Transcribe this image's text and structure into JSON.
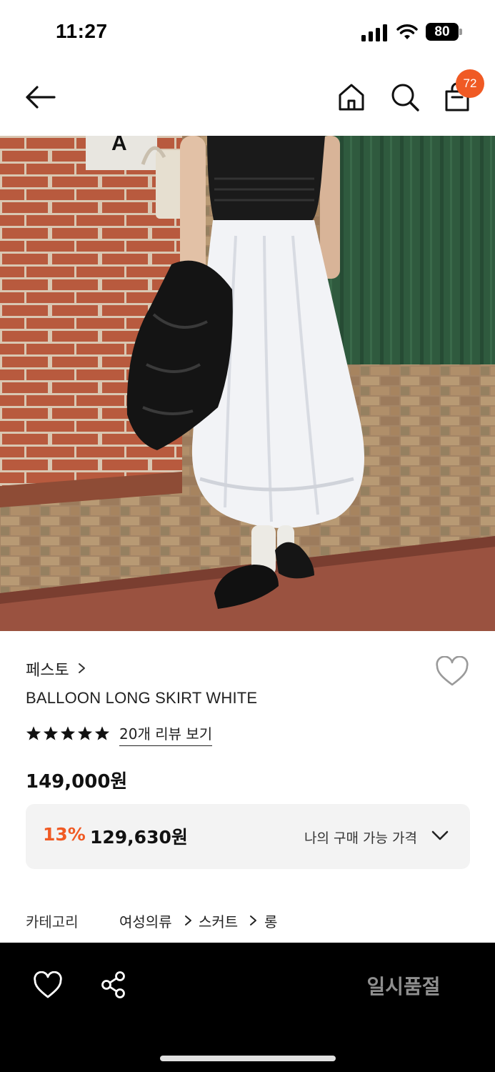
{
  "status_bar": {
    "time": "11:27",
    "battery": "80"
  },
  "nav": {
    "back_icon": "arrow-left-icon",
    "home_icon": "home-icon",
    "search_icon": "search-icon",
    "bag_icon": "shopping-bag-icon",
    "cart_count": "72",
    "badge_color": "#f05a24"
  },
  "product": {
    "brand": "페스토",
    "name": "BALLOON LONG SKIRT WHITE",
    "rating_stars": 5,
    "review_link": "20개 리뷰 보기",
    "price": "149,000원",
    "discount_rate": "13%",
    "discount_price": "129,630원",
    "best_price_label": "나의 구매 가능 가격",
    "accent_color": "#f05a24"
  },
  "category": {
    "label": "카테고리",
    "path": [
      "여성의류",
      "스커트",
      "롱"
    ]
  },
  "bottom_bar": {
    "like_icon": "heart-icon",
    "share_icon": "share-icon",
    "action_label": "일시품절"
  }
}
